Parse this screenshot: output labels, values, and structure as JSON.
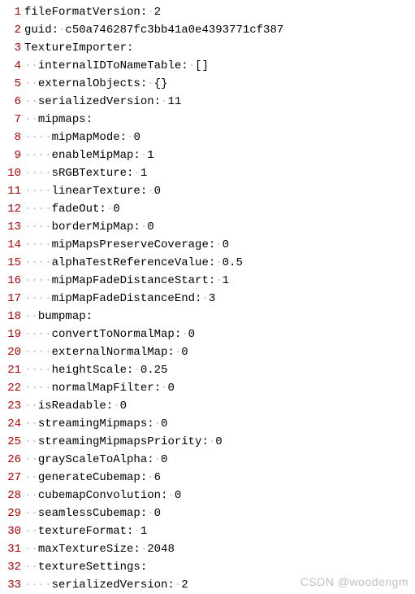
{
  "watermark": "CSDN @woodengm",
  "lines": [
    {
      "n": 1,
      "indent": 0,
      "text": "fileFormatVersion: 2",
      "colon": 17
    },
    {
      "n": 2,
      "indent": 0,
      "text": "guid: c50a746287fc3bb41a0e4393771cf387",
      "colon": 4
    },
    {
      "n": 3,
      "indent": 0,
      "text": "TextureImporter:",
      "colon": 15
    },
    {
      "n": 4,
      "indent": 2,
      "text": "internalIDToNameTable: []",
      "colon": 21
    },
    {
      "n": 5,
      "indent": 2,
      "text": "externalObjects: {}",
      "colon": 15
    },
    {
      "n": 6,
      "indent": 2,
      "text": "serializedVersion: 11",
      "colon": 17
    },
    {
      "n": 7,
      "indent": 2,
      "text": "mipmaps:",
      "colon": 7
    },
    {
      "n": 8,
      "indent": 4,
      "text": "mipMapMode: 0",
      "colon": 10
    },
    {
      "n": 9,
      "indent": 4,
      "text": "enableMipMap: 1",
      "colon": 12
    },
    {
      "n": 10,
      "indent": 4,
      "text": "sRGBTexture: 1",
      "colon": 11
    },
    {
      "n": 11,
      "indent": 4,
      "text": "linearTexture: 0",
      "colon": 13
    },
    {
      "n": 12,
      "indent": 4,
      "text": "fadeOut: 0",
      "colon": 7
    },
    {
      "n": 13,
      "indent": 4,
      "text": "borderMipMap: 0",
      "colon": 12
    },
    {
      "n": 14,
      "indent": 4,
      "text": "mipMapsPreserveCoverage: 0",
      "colon": 23
    },
    {
      "n": 15,
      "indent": 4,
      "text": "alphaTestReferenceValue: 0.5",
      "colon": 23
    },
    {
      "n": 16,
      "indent": 4,
      "text": "mipMapFadeDistanceStart: 1",
      "colon": 23
    },
    {
      "n": 17,
      "indent": 4,
      "text": "mipMapFadeDistanceEnd: 3",
      "colon": 21
    },
    {
      "n": 18,
      "indent": 2,
      "text": "bumpmap:",
      "colon": 7
    },
    {
      "n": 19,
      "indent": 4,
      "text": "convertToNormalMap: 0",
      "colon": 18
    },
    {
      "n": 20,
      "indent": 4,
      "text": "externalNormalMap: 0",
      "colon": 17
    },
    {
      "n": 21,
      "indent": 4,
      "text": "heightScale: 0.25",
      "colon": 11
    },
    {
      "n": 22,
      "indent": 4,
      "text": "normalMapFilter: 0",
      "colon": 15
    },
    {
      "n": 23,
      "indent": 2,
      "text": "isReadable: 0",
      "colon": 10
    },
    {
      "n": 24,
      "indent": 2,
      "text": "streamingMipmaps: 0",
      "colon": 16
    },
    {
      "n": 25,
      "indent": 2,
      "text": "streamingMipmapsPriority: 0",
      "colon": 24
    },
    {
      "n": 26,
      "indent": 2,
      "text": "grayScaleToAlpha: 0",
      "colon": 16
    },
    {
      "n": 27,
      "indent": 2,
      "text": "generateCubemap: 6",
      "colon": 15
    },
    {
      "n": 28,
      "indent": 2,
      "text": "cubemapConvolution: 0",
      "colon": 18
    },
    {
      "n": 29,
      "indent": 2,
      "text": "seamlessCubemap: 0",
      "colon": 15
    },
    {
      "n": 30,
      "indent": 2,
      "text": "textureFormat: 1",
      "colon": 13
    },
    {
      "n": 31,
      "indent": 2,
      "text": "maxTextureSize: 2048",
      "colon": 14
    },
    {
      "n": 32,
      "indent": 2,
      "text": "textureSettings:",
      "colon": 15
    },
    {
      "n": 33,
      "indent": 4,
      "text": "serializedVersion: 2",
      "colon": 17
    }
  ]
}
